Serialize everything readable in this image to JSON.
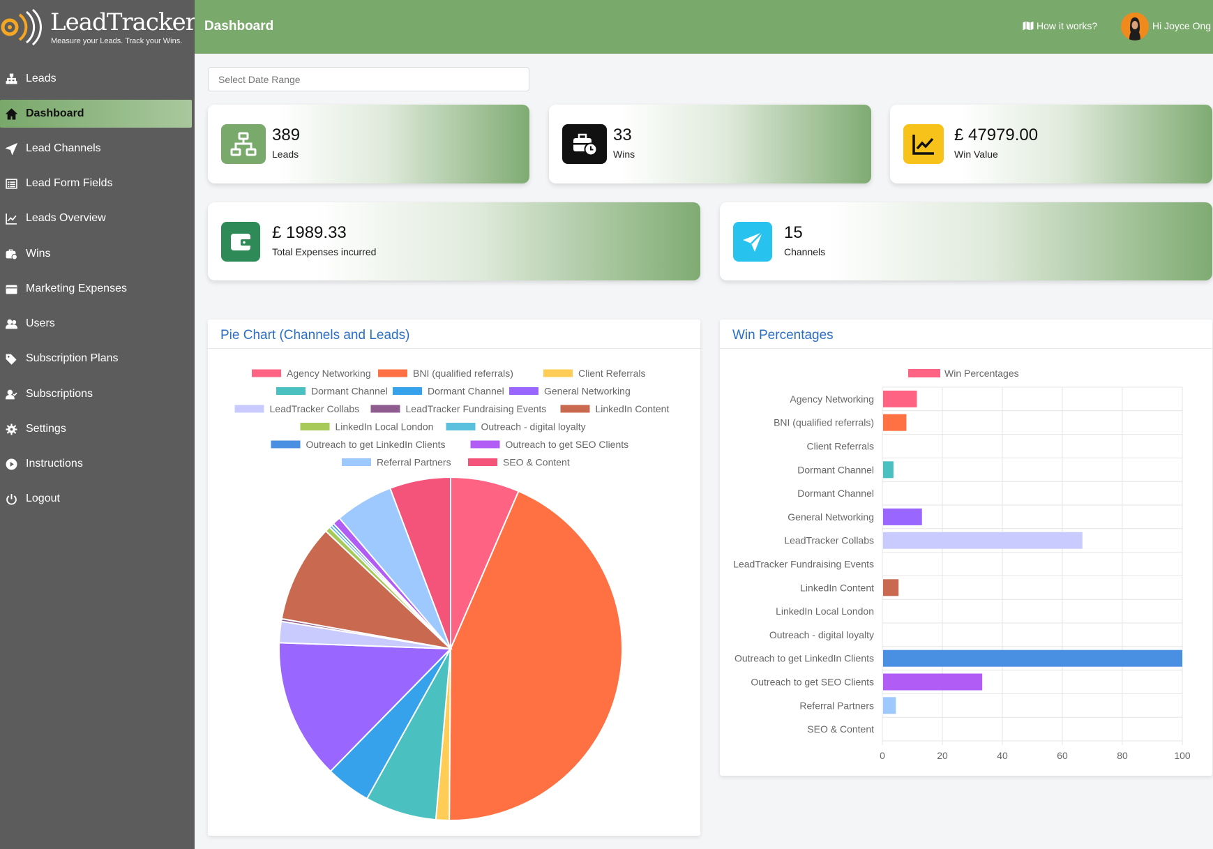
{
  "brand": {
    "name": "LeadTracker",
    "tagline": "Measure your Leads. Track your Wins."
  },
  "sidebar": {
    "items": [
      {
        "label": "Leads",
        "icon": "sitemap-icon",
        "active": false
      },
      {
        "label": "Dashboard",
        "icon": "home-icon",
        "active": true
      },
      {
        "label": "Lead Channels",
        "icon": "send-icon",
        "active": false
      },
      {
        "label": "Lead Form Fields",
        "icon": "list-icon",
        "active": false
      },
      {
        "label": "Leads Overview",
        "icon": "line-chart-icon",
        "active": false
      },
      {
        "label": "Wins",
        "icon": "briefcase-clock-icon",
        "active": false
      },
      {
        "label": "Marketing Expenses",
        "icon": "card-icon",
        "active": false
      },
      {
        "label": "Users",
        "icon": "users-icon",
        "active": false
      },
      {
        "label": "Subscription Plans",
        "icon": "tags-icon",
        "active": false
      },
      {
        "label": "Subscriptions",
        "icon": "user-check-icon",
        "active": false
      },
      {
        "label": "Settings",
        "icon": "gear-icon",
        "active": false
      },
      {
        "label": "Instructions",
        "icon": "play-circle-icon",
        "active": false
      },
      {
        "label": "Logout",
        "icon": "power-icon",
        "active": false
      }
    ]
  },
  "header": {
    "title": "Dashboard",
    "how_it_works": "How it works?",
    "greeting": "Hi Joyce Ong"
  },
  "filters": {
    "date_range_placeholder": "Select Date Range"
  },
  "stats": {
    "leads": {
      "value": "389",
      "label": "Leads",
      "icon": "sitemap-icon",
      "color": "#7aa96c"
    },
    "wins": {
      "value": "33",
      "label": "Wins",
      "icon": "briefcase-clock-icon",
      "color": "#111111"
    },
    "win_value": {
      "value": "£ 47979.00",
      "label": "Win Value",
      "icon": "line-chart-icon",
      "color": "#f7c21a"
    },
    "expenses": {
      "value": "£ 1989.33",
      "label": "Total Expenses incurred",
      "icon": "wallet-icon",
      "color": "#2e8b57"
    },
    "channels": {
      "value": "15",
      "label": "Channels",
      "icon": "send-icon",
      "color": "#27c3ee"
    }
  },
  "panels": {
    "pie_title": "Pie Chart (Channels and Leads)",
    "bar_title": "Win Percentages"
  },
  "chart_data": [
    {
      "type": "pie",
      "title": "Pie Chart (Channels and Leads)",
      "legend_position": "top",
      "categories": [
        "Agency Networking",
        "BNI (qualified referrals)",
        "Client Referrals",
        "Dormant Channel",
        "Dormant Channel",
        "General Networking",
        "LeadTracker Collabs",
        "LeadTracker Fundraising Events",
        "LinkedIn Content",
        "LinkedIn Local London",
        "Outreach - digital loyalty",
        "Outreach to get LinkedIn Clients",
        "Outreach to get SEO Clients",
        "Referral Partners",
        "SEO & Content"
      ],
      "values": [
        26,
        175,
        5,
        27,
        17,
        53,
        8,
        1,
        37,
        2,
        1,
        1,
        3,
        22,
        23
      ],
      "colors": [
        "#ff6384",
        "#ff7043",
        "#ffcd56",
        "#4bc0c0",
        "#36a2eb",
        "#9966ff",
        "#c9cbff",
        "#8e5c8e",
        "#c96a50",
        "#a7c957",
        "#5bc0de",
        "#4a90e2",
        "#b05cf5",
        "#9ec9ff",
        "#f4547a"
      ]
    },
    {
      "type": "bar",
      "orientation": "horizontal",
      "title": "Win Percentages",
      "legend_position": "top",
      "series": [
        {
          "name": "Win Percentages",
          "color": "#ff6384",
          "values": [
            11.5,
            8,
            0,
            3.7,
            0,
            13.2,
            66.7,
            0,
            5.4,
            0,
            0,
            100,
            33.3,
            4.5,
            0
          ]
        }
      ],
      "categories": [
        "Agency Networking",
        "BNI (qualified referrals)",
        "Client Referrals",
        "Dormant Channel",
        "Dormant Channel",
        "General Networking",
        "LeadTracker Collabs",
        "LeadTracker Fundraising Events",
        "LinkedIn Content",
        "LinkedIn Local London",
        "Outreach - digital loyalty",
        "Outreach to get LinkedIn Clients",
        "Outreach to get SEO Clients",
        "Referral Partners",
        "SEO & Content"
      ],
      "bar_colors": [
        "#ff6384",
        "#ff7043",
        "#ffcd56",
        "#4bc0c0",
        "#36a2eb",
        "#9966ff",
        "#c9cbff",
        "#8e5c8e",
        "#c96a50",
        "#a7c957",
        "#5bc0de",
        "#4a90e2",
        "#b05cf5",
        "#9ec9ff",
        "#f4547a"
      ],
      "xlim": [
        0,
        100
      ],
      "xticks": [
        0,
        20,
        40,
        60,
        80,
        100
      ],
      "grid": true
    }
  ]
}
